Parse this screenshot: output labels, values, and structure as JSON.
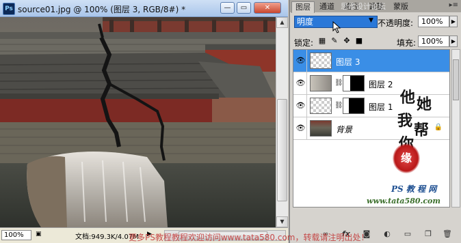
{
  "document": {
    "app_logo": "Ps",
    "title": "source01.jpg @ 100% (图层 3, RGB/8#) *",
    "min_label": "—",
    "restore_label": "▭",
    "close_label": "✕",
    "zoom": "100%",
    "doc_info": "文档:949.3K/4.07M",
    "status_arrow": "▶"
  },
  "panel": {
    "tabs": [
      "图层",
      "通道",
      "路径",
      "调整",
      "蒙版"
    ],
    "menu_icon": "▸≡",
    "blend_mode": "明度",
    "opacity_label": "不透明度:",
    "opacity_value": "100%",
    "lock_label": "锁定:",
    "fill_label": "填充:",
    "fill_value": "100%",
    "layers": [
      {
        "name": "图层 3",
        "selected": true,
        "has_mask": false
      },
      {
        "name": "图层 2",
        "selected": false,
        "has_mask": true
      },
      {
        "name": "图层 1",
        "selected": false,
        "has_mask": true
      },
      {
        "name": "背景",
        "selected": false,
        "has_mask": false,
        "locked": true
      }
    ],
    "bottom_icons": [
      "link-icon",
      "fx-icon",
      "mask-icon",
      "adjustment-icon",
      "folder-icon",
      "new-layer-icon",
      "trash-icon"
    ]
  },
  "watermark": {
    "calligraphy": [
      "他",
      "她",
      "我",
      "帮",
      "你"
    ],
    "seal": "缘",
    "ps_site": "PS 教 程 网",
    "url": "www.tata580.com",
    "top": "思缘设计论坛",
    "bottom": "更多PS教程教程欢迎访问www.tata580.com，转载请注明出处！"
  },
  "colors": {
    "selection": "#3a8ee6",
    "blend_bg": "#2a78d8",
    "title_bar": "#a9c5ea"
  }
}
